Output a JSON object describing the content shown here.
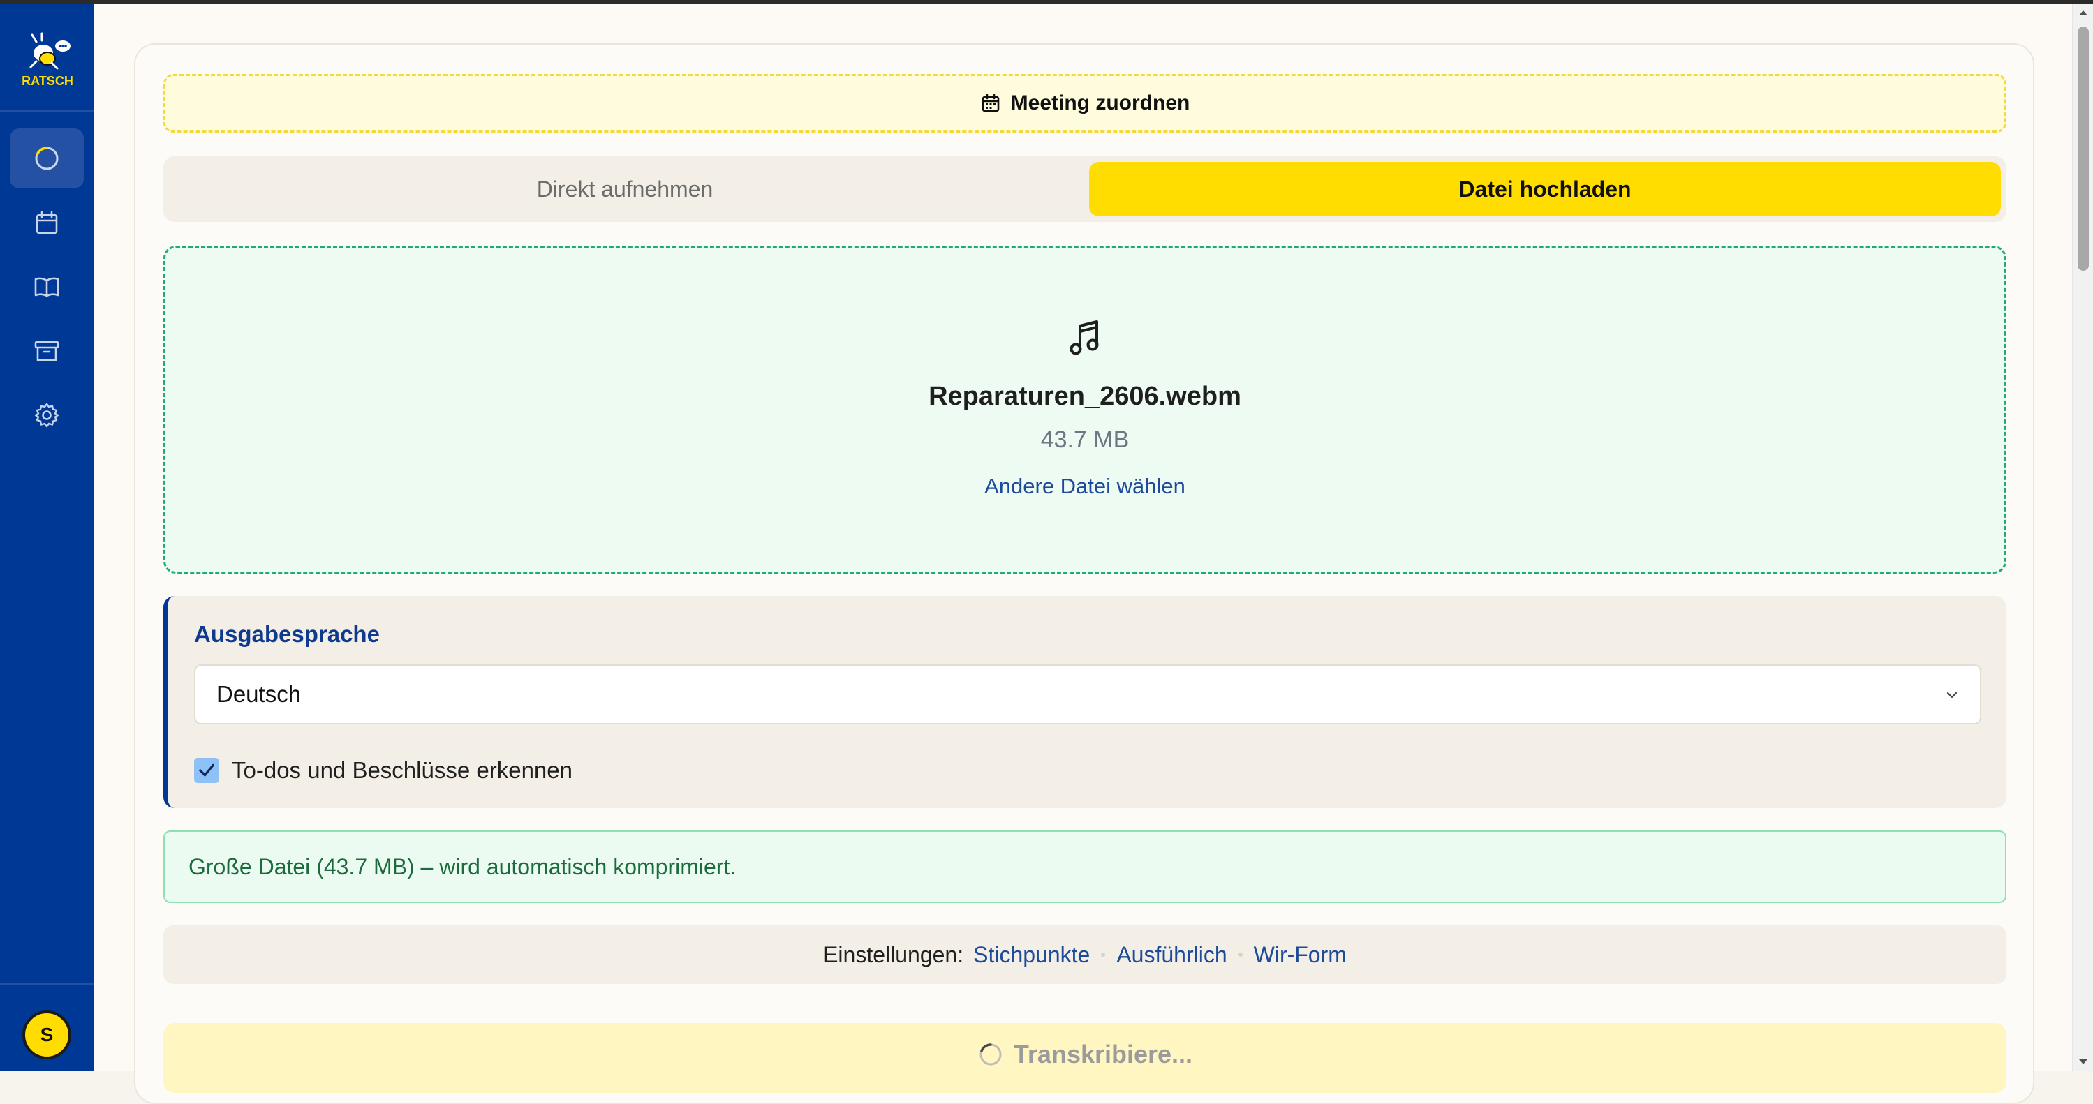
{
  "app": {
    "logo_text": "RATSCH",
    "avatar_initial": "S"
  },
  "sidebar": {
    "items": [
      {
        "name": "loading",
        "icon": "spinner-icon",
        "active": true
      },
      {
        "name": "calendar",
        "icon": "calendar-icon",
        "active": false
      },
      {
        "name": "book",
        "icon": "book-icon",
        "active": false
      },
      {
        "name": "archive",
        "icon": "archive-icon",
        "active": false
      },
      {
        "name": "settings",
        "icon": "gear-icon",
        "active": false
      }
    ]
  },
  "meeting": {
    "label": "Meeting zuordnen",
    "icon": "calendar-icon"
  },
  "mode_tabs": {
    "record_label": "Direkt aufnehmen",
    "upload_label": "Datei hochladen",
    "selected": "upload"
  },
  "file": {
    "icon": "music-note-icon",
    "name": "Reparaturen_2606.webm",
    "size": "43.7 MB",
    "change_label": "Andere Datei wählen"
  },
  "output_language": {
    "label": "Ausgabesprache",
    "selected": "Deutsch",
    "detect_todos_label": "To-dos und Beschlüsse erkennen",
    "detect_todos_checked": true
  },
  "info": {
    "message": "Große Datei (43.7 MB) – wird automatisch komprimiert."
  },
  "settings": {
    "label": "Einstellungen:",
    "options": [
      "Stichpunkte",
      "Ausführlich",
      "Wir-Form"
    ]
  },
  "action": {
    "label": "Transkribiere...",
    "icon": "spinner-icon"
  },
  "colors": {
    "sidebar_bg": "#003896",
    "accent_yellow": "#ffdd00",
    "dropzone_border": "#1faa7a",
    "link_blue": "#1d4b9a",
    "info_text": "#1b6b3d"
  }
}
